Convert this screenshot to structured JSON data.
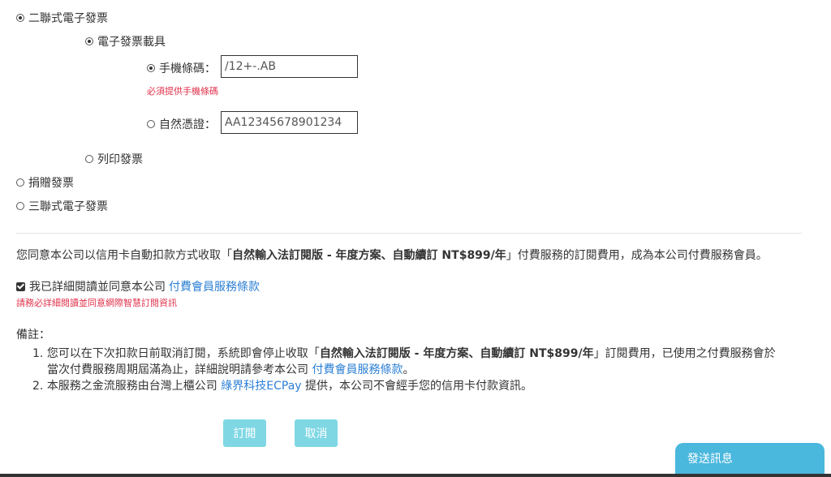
{
  "invoice_options": {
    "duplicate": {
      "label": "二聯式電子發票",
      "selected": true
    },
    "carrier": {
      "label": "電子發票載具",
      "selected": true
    },
    "mobile": {
      "label": "手機條碼：",
      "value": "/12+-.AB",
      "error": "必須提供手機條碼",
      "selected": true
    },
    "natural": {
      "label": "自然憑證：",
      "value": "AA12345678901234",
      "selected": false
    },
    "print": {
      "label": "列印發票",
      "selected": false
    },
    "donate": {
      "label": "捐贈發票",
      "selected": false
    },
    "triplicate": {
      "label": "三聯式電子發票",
      "selected": false
    }
  },
  "consent": {
    "prefix": "您同意本公司以信用卡自動扣款方式收取「",
    "plan": "自然輸入法訂閱版 - 年度方案、自動續訂 NT$899/年",
    "suffix": "」付費服務的訂閱費用，成為本公司付費服務會員。"
  },
  "agreement": {
    "label": "我已詳細閱讀並同意本公司",
    "link": "付費會員服務條款",
    "checked": true,
    "error": "請務必詳細閱讀並同意網際智慧訂閱資訊"
  },
  "notes": {
    "title": "備註：",
    "item1_prefix": "您可以在下次扣款日前取消訂閱，系統即會停止收取「",
    "item1_plan": "自然輸入法訂閱版 - 年度方案、自動續訂 NT$899/年",
    "item1_suffix": "」訂閱費用，已使用之付費服務會於",
    "item1_line2_prefix": "當次付費服務周期屆滿為止，詳細說明請參考本公司",
    "item1_link": "付費會員服務條款",
    "item1_line2_suffix": "。",
    "item2_prefix": "本服務之金流服務由台灣上櫃公司",
    "item2_link": "綠界科技ECPay",
    "item2_suffix": "提供，本公司不會經手您的信用卡付款資訊。"
  },
  "buttons": {
    "subscribe": "訂閱",
    "cancel": "取消"
  },
  "chat": {
    "label": "發送訊息"
  }
}
